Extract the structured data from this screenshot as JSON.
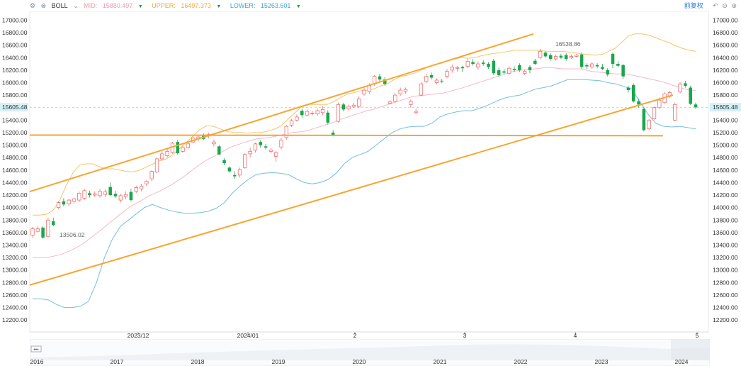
{
  "toolbar": {
    "indicator": "BOLL",
    "mid_label": "MID:",
    "mid_value": "15880.497",
    "upper_label": "UPPER:",
    "upper_value": "16497.373",
    "lower_label": "LOWER:",
    "lower_value": "15263.601",
    "fq_label": "前复权",
    "icons": [
      "settings-icon",
      "close-icon",
      "chevron-down-icon",
      "undo-icon",
      "zoom-out-icon",
      "zoom-in-icon"
    ]
  },
  "colors": {
    "up": "#f26d6d",
    "down": "#1aa64b",
    "mid": "#f5b8c6",
    "upper": "#f5c56a",
    "lower": "#74bfe0",
    "trend": "#f7a531",
    "price_label": "#d3f0f5"
  },
  "chart_data": {
    "type": "candlestick",
    "y_ticks": [
      "17000.00",
      "16800.00",
      "16600.00",
      "16400.00",
      "16200.00",
      "16000.00",
      "15800.00",
      "15605.48",
      "15400.00",
      "15200.00",
      "15000.00",
      "14800.00",
      "14600.00",
      "14400.00",
      "14200.00",
      "14000.00",
      "13800.00",
      "13600.00",
      "13400.00",
      "13200.00",
      "13000.00",
      "12800.00",
      "12600.00",
      "12400.00",
      "12200.00"
    ],
    "ylim": [
      12100,
      17050
    ],
    "x_ticks": [
      "2023/12",
      "2024/01",
      "2",
      "3",
      "4",
      "5"
    ],
    "last_price": 15605.48,
    "last_price_label": "15605.48",
    "high_annotation": {
      "label": "16538.86",
      "value": 16538.86
    },
    "low_annotation": {
      "label": "13506.02",
      "value": 13506.02
    },
    "navigator_years": [
      "2016",
      "2017",
      "2018",
      "2019",
      "2020",
      "2021",
      "2022",
      "2023",
      "2024"
    ],
    "candles": [
      [
        13560,
        13660,
        13520,
        13690
      ],
      [
        13620,
        13660,
        13600,
        13700
      ],
      [
        13680,
        13520,
        13500,
        13700
      ],
      [
        13540,
        13800,
        13520,
        13840
      ],
      [
        13780,
        13720,
        13700,
        13840
      ],
      [
        14000,
        14080,
        13980,
        14100
      ],
      [
        14100,
        14050,
        14020,
        14150
      ],
      [
        14060,
        14120,
        14020,
        14140
      ],
      [
        14100,
        14140,
        14060,
        14160
      ],
      [
        14120,
        14230,
        14090,
        14260
      ],
      [
        14150,
        14270,
        14120,
        14300
      ],
      [
        14230,
        14200,
        14160,
        14270
      ],
      [
        14200,
        14220,
        14170,
        14260
      ],
      [
        14190,
        14260,
        14160,
        14300
      ],
      [
        14210,
        14250,
        14170,
        14290
      ],
      [
        14330,
        14200,
        14180,
        14400
      ],
      [
        14220,
        14180,
        14150,
        14270
      ],
      [
        14120,
        14190,
        14080,
        14220
      ],
      [
        14180,
        14210,
        14130,
        14260
      ],
      [
        14250,
        14120,
        14100,
        14300
      ],
      [
        14260,
        14320,
        14230,
        14350
      ],
      [
        14300,
        14340,
        14260,
        14380
      ],
      [
        14380,
        14420,
        14340,
        14440
      ],
      [
        14460,
        14580,
        14420,
        14600
      ],
      [
        14570,
        14780,
        14550,
        14800
      ],
      [
        14780,
        14860,
        14750,
        14900
      ],
      [
        14830,
        14900,
        14800,
        14940
      ],
      [
        14880,
        15030,
        14860,
        15050
      ],
      [
        15050,
        14870,
        14850,
        15080
      ],
      [
        14900,
        14960,
        14880,
        15000
      ],
      [
        14960,
        15020,
        14940,
        15060
      ],
      [
        15050,
        15110,
        15030,
        15140
      ],
      [
        15100,
        15130,
        15060,
        15160
      ],
      [
        15150,
        15100,
        15080,
        15190
      ],
      [
        15150,
        15170,
        15110,
        15200
      ],
      [
        15020,
        15050,
        14980,
        15090
      ],
      [
        14980,
        14850,
        14840,
        15000
      ],
      [
        14760,
        14710,
        14680,
        14790
      ],
      [
        14640,
        14580,
        14560,
        14660
      ],
      [
        14520,
        14500,
        14460,
        14580
      ],
      [
        14520,
        14610,
        14480,
        14640
      ],
      [
        14640,
        14850,
        14620,
        14870
      ],
      [
        14860,
        14900,
        14800,
        14960
      ],
      [
        14920,
        15020,
        14880,
        15040
      ],
      [
        15050,
        15000,
        14960,
        15080
      ],
      [
        14980,
        14960,
        14930,
        15020
      ],
      [
        14900,
        14920,
        14870,
        14950
      ],
      [
        14820,
        14880,
        14730,
        14910
      ],
      [
        14970,
        15080,
        14930,
        15120
      ],
      [
        15120,
        15300,
        15090,
        15320
      ],
      [
        15320,
        15390,
        15290,
        15420
      ],
      [
        15400,
        15450,
        15380,
        15490
      ],
      [
        15550,
        15480,
        15440,
        15580
      ],
      [
        15480,
        15540,
        15460,
        15570
      ],
      [
        15500,
        15510,
        15470,
        15550
      ],
      [
        15500,
        15550,
        15470,
        15580
      ],
      [
        15520,
        15570,
        15480,
        15620
      ],
      [
        15520,
        15360,
        15330,
        15560
      ],
      [
        15200,
        15160,
        15140,
        15240
      ],
      [
        15380,
        15650,
        15360,
        15680
      ],
      [
        15650,
        15570,
        15540,
        15680
      ],
      [
        15580,
        15620,
        15550,
        15650
      ],
      [
        15620,
        15640,
        15590,
        15680
      ],
      [
        15620,
        15740,
        15590,
        15780
      ],
      [
        15820,
        15880,
        15790,
        15920
      ],
      [
        15860,
        15950,
        15820,
        15990
      ],
      [
        15980,
        16100,
        15950,
        16120
      ],
      [
        16100,
        16050,
        16020,
        16140
      ],
      [
        16050,
        15980,
        15950,
        16090
      ],
      [
        15670,
        15690,
        15650,
        15720
      ],
      [
        15700,
        15800,
        15680,
        15830
      ],
      [
        15820,
        15880,
        15790,
        15920
      ],
      [
        15860,
        15890,
        15820,
        15920
      ],
      [
        15650,
        15700,
        15600,
        15730
      ],
      [
        15520,
        15540,
        15490,
        15580
      ],
      [
        15800,
        15980,
        15780,
        16010
      ],
      [
        16020,
        16100,
        15990,
        16140
      ],
      [
        16120,
        16080,
        16050,
        16160
      ],
      [
        16000,
        16040,
        15970,
        16070
      ],
      [
        16030,
        16020,
        15990,
        16060
      ],
      [
        16100,
        16180,
        16070,
        16220
      ],
      [
        16200,
        16250,
        16160,
        16290
      ],
      [
        16230,
        16240,
        16180,
        16270
      ],
      [
        16250,
        16230,
        16170,
        16270
      ],
      [
        16260,
        16340,
        16230,
        16380
      ],
      [
        16330,
        16300,
        16270,
        16380
      ],
      [
        16250,
        16300,
        16200,
        16340
      ],
      [
        16320,
        16300,
        16270,
        16360
      ],
      [
        16300,
        16250,
        16220,
        16330
      ],
      [
        16350,
        16150,
        16120,
        16380
      ],
      [
        16200,
        16120,
        16090,
        16240
      ],
      [
        16180,
        16160,
        16130,
        16220
      ],
      [
        16150,
        16230,
        16120,
        16260
      ],
      [
        16220,
        16200,
        16170,
        16260
      ],
      [
        16280,
        16200,
        16170,
        16310
      ],
      [
        16150,
        16180,
        16120,
        16210
      ],
      [
        16250,
        16200,
        16150,
        16280
      ],
      [
        16350,
        16300,
        16280,
        16380
      ],
      [
        16400,
        16500,
        16380,
        16539
      ],
      [
        16480,
        16420,
        16400,
        16500
      ],
      [
        16440,
        16380,
        16350,
        16470
      ],
      [
        16380,
        16420,
        16350,
        16450
      ],
      [
        16430,
        16400,
        16380,
        16460
      ],
      [
        16440,
        16380,
        16350,
        16470
      ],
      [
        16400,
        16420,
        16380,
        16450
      ],
      [
        16420,
        16440,
        16400,
        16460
      ],
      [
        16450,
        16250,
        16220,
        16480
      ],
      [
        16280,
        16260,
        16220,
        16310
      ],
      [
        16250,
        16300,
        16220,
        16330
      ],
      [
        16280,
        16260,
        16230,
        16310
      ],
      [
        16250,
        16220,
        16200,
        16300
      ],
      [
        16200,
        16130,
        16100,
        16230
      ],
      [
        16460,
        16300,
        16230,
        16480
      ],
      [
        16300,
        16270,
        16240,
        16340
      ],
      [
        16280,
        16100,
        16060,
        16300
      ],
      [
        15920,
        15880,
        15840,
        15950
      ],
      [
        15960,
        15700,
        15680,
        15990
      ],
      [
        15700,
        15650,
        15600,
        15740
      ],
      [
        15580,
        15240,
        15220,
        15610
      ],
      [
        15260,
        15400,
        15240,
        15420
      ],
      [
        15420,
        15600,
        15400,
        15620
      ],
      [
        15600,
        15720,
        15580,
        15760
      ],
      [
        15680,
        15820,
        15660,
        15850
      ],
      [
        15780,
        15840,
        15750,
        15870
      ],
      [
        15400,
        15650,
        15380,
        15680
      ],
      [
        15850,
        15980,
        15830,
        16010
      ],
      [
        15990,
        15950,
        15920,
        16030
      ],
      [
        15920,
        15660,
        15640,
        15950
      ],
      [
        15650,
        15605,
        15580,
        15680
      ]
    ],
    "mid_line": [
      13200,
      13200,
      13200,
      13210,
      13230,
      13250,
      13290,
      13330,
      13380,
      13440,
      13510,
      13580,
      13650,
      13730,
      13800,
      13880,
      13950,
      14020,
      14070,
      14120,
      14180,
      14220,
      14260,
      14310,
      14360,
      14420,
      14480,
      14550,
      14620,
      14690,
      14750,
      14800,
      14850,
      14900,
      14950,
      14990,
      15020,
      15050,
      15080,
      15100,
      15110,
      15120,
      15140,
      15160,
      15180,
      15200,
      15210,
      15220,
      15240,
      15270,
      15300,
      15330,
      15360,
      15400,
      15430,
      15460,
      15490,
      15520,
      15550,
      15570,
      15600,
      15630,
      15660,
      15690,
      15720,
      15750,
      15780,
      15790,
      15800,
      15810,
      15820,
      15830,
      15850,
      15880,
      15900,
      15930,
      15960,
      15990,
      16020,
      16050,
      16080,
      16110,
      16140,
      16170,
      16190,
      16200,
      16210,
      16220,
      16230,
      16240,
      16240,
      16230,
      16220,
      16220,
      16220,
      16220,
      16200,
      16180,
      16170,
      16160,
      16150,
      16140,
      16140,
      16130,
      16120,
      16100,
      16080,
      16060,
      16040,
      16020,
      15990,
      15960,
      15930,
      15900,
      15880,
      15880
    ],
    "upper_line": [
      13880,
      13880,
      13890,
      13950,
      14100,
      14350,
      14550,
      14680,
      14700,
      14700,
      14650,
      14620,
      14620,
      14600,
      14580,
      14570,
      14600,
      14650,
      14700,
      14750,
      14780,
      14850,
      14950,
      15050,
      15150,
      15250,
      15310,
      15300,
      15260,
      15220,
      15200,
      15200,
      15190,
      15200,
      15200,
      15220,
      15250,
      15300,
      15400,
      15500,
      15600,
      15650,
      15650,
      15650,
      15650,
      15700,
      15760,
      15820,
      15840,
      15870,
      15880,
      15900,
      15950,
      15980,
      16050,
      16100,
      16120,
      16150,
      16200,
      16250,
      16290,
      16310,
      16350,
      16380,
      16400,
      16390,
      16400,
      16430,
      16450,
      16470,
      16480,
      16500,
      16520,
      16520,
      16520,
      16520,
      16510,
      16500,
      16500,
      16500,
      16490,
      16480,
      16460,
      16450,
      16440,
      16450,
      16500,
      16550,
      16650,
      16750,
      16780,
      16780,
      16760,
      16720,
      16680,
      16640,
      16590,
      16550,
      16520,
      16500
    ],
    "lower_line": [
      12540,
      12540,
      12520,
      12450,
      12400,
      12400,
      12420,
      12500,
      12800,
      13200,
      13500,
      13700,
      13800,
      13900,
      14000,
      14050,
      14000,
      13960,
      13930,
      13910,
      13910,
      13920,
      13940,
      13990,
      14080,
      14230,
      14350,
      14450,
      14530,
      14550,
      14560,
      14550,
      14530,
      14460,
      14400,
      14380,
      14400,
      14450,
      14550,
      14700,
      14800,
      14850,
      14900,
      15000,
      15100,
      15200,
      15260,
      15290,
      15300,
      15300,
      15350,
      15450,
      15500,
      15530,
      15550,
      15550,
      15590,
      15640,
      15700,
      15750,
      15780,
      15800,
      15850,
      15900,
      15920,
      15950,
      16000,
      16050,
      16050,
      16050,
      16040,
      16030,
      16000,
      15980,
      15940,
      15900,
      15700,
      15500,
      15350,
      15300,
      15290,
      15300,
      15280,
      15260
    ]
  }
}
